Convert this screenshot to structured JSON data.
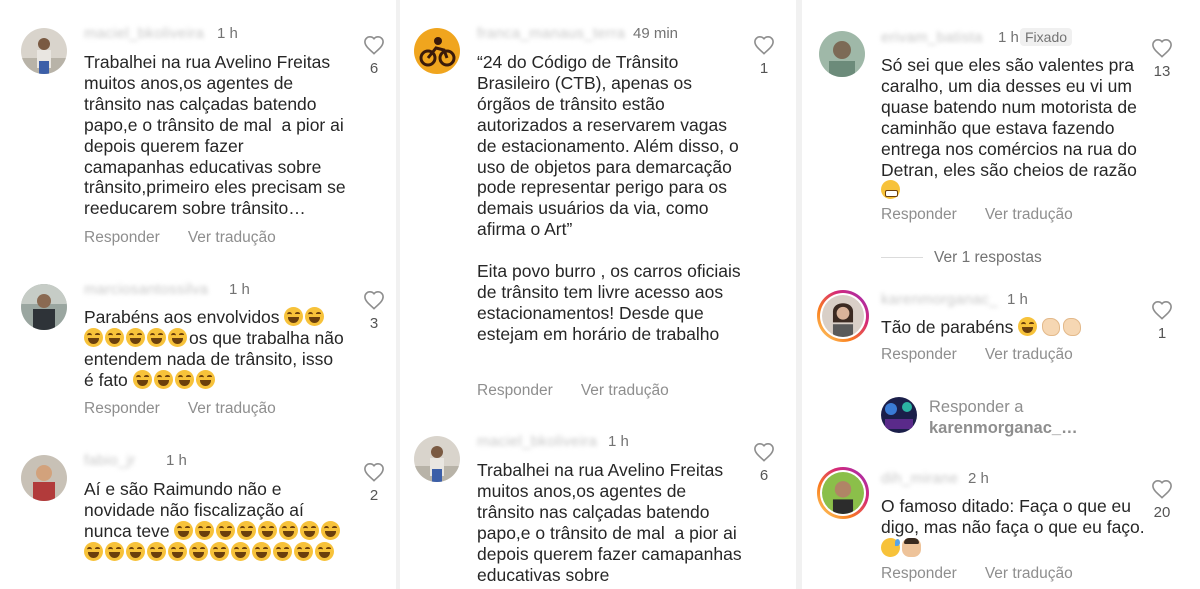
{
  "columns": [
    {
      "comments": [
        {
          "username": "maciel_bkoliveira",
          "time": "1 h",
          "text": "Trabalhei na rua Avelino Freitas muitos anos,os agentes de trânsito nas calçadas batendo papo,e o trânsito de mal  a pior ai depois querem fazer camapanhas educativas sobre trânsito,primeiro eles precisam se reeducarem sobre trânsito…",
          "likes": "6",
          "reply_label": "Responder",
          "translate_label": "Ver tradução"
        },
        {
          "username": "marciosantossilva",
          "time": "1 h",
          "text_parts": [
            "Parabéns aos envolvidos ",
            "os que trabalha não entendem nada de trânsito, isso é fato "
          ],
          "likes": "3",
          "reply_label": "Responder",
          "translate_label": "Ver tradução"
        },
        {
          "username": "fabio_jr",
          "time": "1 h",
          "text_parts": [
            "Aí e são Raimundo não e novidade não fiscalização aí nunca teve "
          ],
          "likes": "2"
        }
      ]
    },
    {
      "comments": [
        {
          "username": "franca_manaus_terra",
          "time": "49 min",
          "text": "“24 do Código de Trânsito Brasileiro (CTB), apenas os órgãos de trânsito estão autorizados a reservarem vagas de estacionamento. Além disso, o uso de objetos para demarcação pode representar perigo para os demais usuários da via, como afirma o Art”\n\nEita povo burro , os carros oficiais de trânsito tem livre acesso aos estacionamentos! Desde que estejam em horário de trabalho",
          "likes": "1",
          "reply_label": "Responder",
          "translate_label": "Ver tradução"
        },
        {
          "username": "maciel_bkoliveira",
          "time": "1 h",
          "text": "Trabalhei na rua Avelino Freitas muitos anos,os agentes de trânsito nas calçadas batendo papo,e o trânsito de mal  a pior ai depois querem fazer camapanhas educativas sobre",
          "likes": "6"
        }
      ]
    },
    {
      "comments": [
        {
          "username": "erivam_batista",
          "time": "1 h",
          "badge": "Fixado",
          "text": "Só sei que eles são valentes pra caralho, um dia desses eu vi um quase batendo num motorista de caminhão que estava fazendo entrega nos comércios na rua do Detran, eles são cheios de razão ",
          "likes": "13",
          "reply_label": "Responder",
          "translate_label": "Ver tradução",
          "view_replies": "Ver 1 respostas"
        },
        {
          "username": "karenmorganac_",
          "time": "1 h",
          "text": "Tão de parabéns ",
          "likes": "1",
          "reply_label": "Responder",
          "translate_label": "Ver tradução"
        },
        {
          "reply_prompt": "Responder a",
          "reply_to": "karenmorganac_…"
        },
        {
          "username": "dih_mirane",
          "time": "2 h",
          "text": "O famoso ditado: Faça o que eu digo, mas não faça o que eu faço. ",
          "likes": "20",
          "reply_label": "Responder",
          "translate_label": "Ver tradução"
        }
      ]
    }
  ],
  "icons": {
    "like": "heart-outline-icon",
    "laugh": "face-with-tears-of-joy-icon"
  },
  "colors": {
    "text": "#262626",
    "muted": "#8e8e8e",
    "username_blurred": "#c7c7c7"
  }
}
